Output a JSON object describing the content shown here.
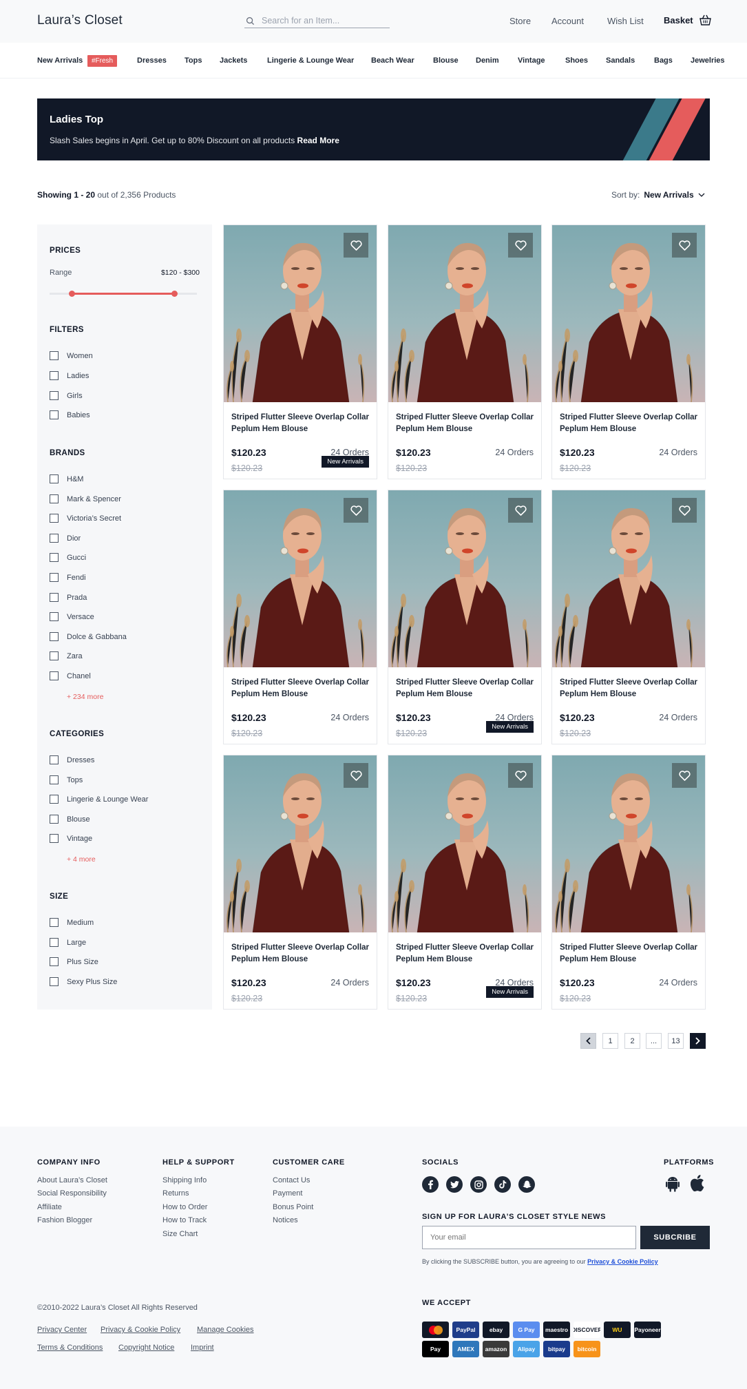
{
  "header": {
    "logo": "Laura’s Closet",
    "search_placeholder": "Search for an Item...",
    "nav": [
      "Store",
      "Account",
      "Wish List"
    ],
    "basket": "Basket"
  },
  "categories": [
    "New Arrivals",
    "Dresses",
    "Tops",
    "Jackets",
    "Lingerie & Lounge Wear",
    "Beach Wear",
    "Blouse",
    "Denim",
    "Vintage",
    "Shoes",
    "Sandals",
    "Bags",
    "Jewelries"
  ],
  "fresh_badge": "#Fresh",
  "banner": {
    "title": "Ladies Top",
    "text": "Slash Sales begins in April. Get up to 80% Discount on all products ",
    "link": "Read More",
    "colors": {
      "bg": "#111827",
      "teal": "#3b7a8a",
      "coral": "#e55c5c"
    }
  },
  "showing": {
    "bold": "Showing 1 - 20",
    "rest": " out of 2,356 Products"
  },
  "sort": {
    "label": "Sort by:",
    "value": "New Arrivals"
  },
  "sidebar": {
    "prices": {
      "title": "PRICES",
      "range_label": "Range",
      "range_value": "$120 - $300",
      "range_low": 0.15,
      "range_high": 0.85
    },
    "filters": {
      "title": "FILTERS",
      "items": [
        "Women",
        "Ladies",
        "Girls",
        "Babies"
      ]
    },
    "brands": {
      "title": "BRANDS",
      "items": [
        "H&M",
        "Mark & Spencer",
        "Victoria’s Secret",
        "Dior",
        "Gucci",
        "Fendi",
        "Prada",
        "Versace",
        "Dolce & Gabbana",
        "Zara",
        "Chanel"
      ],
      "more": "+ 234 more"
    },
    "categories": {
      "title": "CATEGORIES",
      "items": [
        "Dresses",
        "Tops",
        "Lingerie & Lounge Wear",
        "Blouse",
        "Vintage"
      ],
      "more": "+ 4 more"
    },
    "size": {
      "title": "SIZE",
      "items": [
        "Medium",
        "Large",
        "Plus Size",
        "Sexy Plus Size"
      ]
    }
  },
  "products": [
    {
      "title": "Striped Flutter Sleeve Overlap Collar Peplum Hem Blouse",
      "price": "$120.23",
      "old_price": "$120.23",
      "orders": "24 Orders",
      "badge": "New Arrivals"
    },
    {
      "title": "Striped Flutter Sleeve Overlap Collar Peplum Hem Blouse",
      "price": "$120.23",
      "old_price": "$120.23",
      "orders": "24 Orders",
      "badge": ""
    },
    {
      "title": "Striped Flutter Sleeve Overlap Collar Peplum Hem Blouse",
      "price": "$120.23",
      "old_price": "$120.23",
      "orders": "24 Orders",
      "badge": ""
    },
    {
      "title": "Striped Flutter Sleeve Overlap Collar Peplum Hem Blouse",
      "price": "$120.23",
      "old_price": "$120.23",
      "orders": "24 Orders",
      "badge": ""
    },
    {
      "title": "Striped Flutter Sleeve Overlap Collar Peplum Hem Blouse",
      "price": "$120.23",
      "old_price": "$120.23",
      "orders": "24 Orders",
      "badge": "New Arrivals"
    },
    {
      "title": "Striped Flutter Sleeve Overlap Collar Peplum Hem Blouse",
      "price": "$120.23",
      "old_price": "$120.23",
      "orders": "24 Orders",
      "badge": ""
    },
    {
      "title": "Striped Flutter Sleeve Overlap Collar Peplum Hem Blouse",
      "price": "$120.23",
      "old_price": "$120.23",
      "orders": "24 Orders",
      "badge": ""
    },
    {
      "title": "Striped Flutter Sleeve Overlap Collar Peplum Hem Blouse",
      "price": "$120.23",
      "old_price": "$120.23",
      "orders": "24 Orders",
      "badge": "New Arrivals"
    },
    {
      "title": "Striped Flutter Sleeve Overlap Collar Peplum Hem Blouse",
      "price": "$120.23",
      "old_price": "$120.23",
      "orders": "24 Orders",
      "badge": ""
    }
  ],
  "pagination": {
    "pages": [
      "1",
      "2",
      "...",
      "13"
    ]
  },
  "footer": {
    "company": {
      "title": "COMPANY INFO",
      "links": [
        "About Laura’s Closet",
        "Social Responsibility",
        "Affiliate",
        "Fashion Blogger"
      ]
    },
    "help": {
      "title": "HELP & SUPPORT",
      "links": [
        "Shipping Info",
        "Returns",
        "How to Order",
        "How to Track",
        "Size Chart"
      ]
    },
    "care": {
      "title": "CUSTOMER CARE",
      "links": [
        "Contact Us",
        "Payment",
        "Bonus Point",
        "Notices"
      ]
    },
    "socials_title": "SOCIALS",
    "socials": [
      "facebook-icon",
      "twitter-icon",
      "instagram-icon",
      "tiktok-icon",
      "snapchat-icon"
    ],
    "platforms_title": "PLATFORMS",
    "newsletter_title": "SIGN UP FOR LAURA’S CLOSET  STYLE NEWS",
    "email_placeholder": "Your email",
    "subscribe": "SUBCRIBE",
    "agree_text": "By clicking the SUBSCRIBE button, you are agreeing to our ",
    "agree_link": "Privacy & Cookie Policy",
    "copyright": "©2010-2022 Laura’s Closet All Rights Reserved",
    "legal_row1": [
      "Privacy Center",
      "Privacy & Cookie Policy",
      "Manage Cookies"
    ],
    "legal_row2": [
      "Terms & Conditions",
      "Copyright Notice",
      "Imprint"
    ],
    "we_accept": "WE ACCEPT",
    "payments_row1": [
      {
        "name": "mastercard",
        "label": "",
        "bg": "#111827"
      },
      {
        "name": "paypal",
        "label": "PayPal",
        "bg": "#1f3d8a"
      },
      {
        "name": "ebay",
        "label": "ebay",
        "bg": "#111827"
      },
      {
        "name": "google-pay",
        "label": "G Pay",
        "bg": "#5b8def"
      },
      {
        "name": "maestro",
        "label": "maestro",
        "bg": "#111827"
      },
      {
        "name": "discover",
        "label": "DISCOVER",
        "bg": "#ffffff"
      },
      {
        "name": "western-union",
        "label": "WU",
        "bg": "#111827"
      },
      {
        "name": "payoneer",
        "label": "Payoneer",
        "bg": "#111827"
      }
    ],
    "payments_row2": [
      {
        "name": "apple-pay",
        "label": "Pay",
        "bg": "#000000"
      },
      {
        "name": "american-express",
        "label": "AMEX",
        "bg": "#2e77bb"
      },
      {
        "name": "amazon",
        "label": "amazon",
        "bg": "#3a3a3a"
      },
      {
        "name": "alipay",
        "label": "Alipay",
        "bg": "#4aa3e8"
      },
      {
        "name": "bitpay",
        "label": "bitpay",
        "bg": "#1a3b8c"
      },
      {
        "name": "bitcoin",
        "label": "bitcoin",
        "bg": "#f7931a"
      }
    ]
  }
}
